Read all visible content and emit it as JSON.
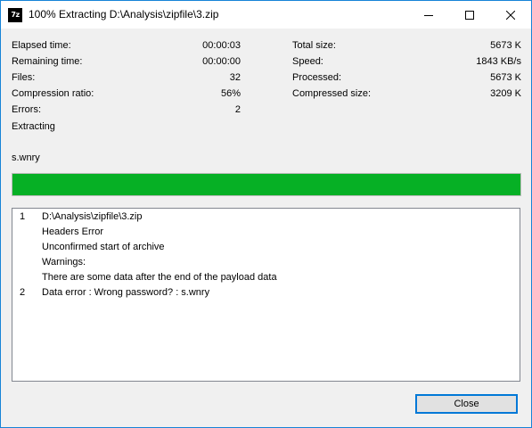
{
  "window": {
    "title": "100% Extracting D:\\Analysis\\zipfile\\3.zip",
    "app_icon_text": "7z",
    "accent_color": "#1784d7"
  },
  "stats_left": [
    {
      "label": "Elapsed time:",
      "value": "00:00:03"
    },
    {
      "label": "Remaining time:",
      "value": "00:00:00"
    },
    {
      "label": "Files:",
      "value": "32"
    },
    {
      "label": "Compression ratio:",
      "value": "56%"
    },
    {
      "label": "Errors:",
      "value": "2"
    }
  ],
  "stats_right": [
    {
      "label": "Total size:",
      "value": "5673 K"
    },
    {
      "label": "Speed:",
      "value": "1843 KB/s"
    },
    {
      "label": "Processed:",
      "value": "5673 K"
    },
    {
      "label": "Compressed size:",
      "value": "3209 K"
    }
  ],
  "status": "Extracting",
  "current_file": "s.wnry",
  "progress": {
    "percent": 100,
    "color": "#06b025"
  },
  "log": [
    {
      "num": "1",
      "text": "D:\\Analysis\\zipfile\\3.zip"
    },
    {
      "num": "",
      "text": "Headers Error"
    },
    {
      "num": "",
      "text": "Unconfirmed start of archive"
    },
    {
      "num": "",
      "text": "Warnings:"
    },
    {
      "num": "",
      "text": "There are some data after the end of the payload data"
    },
    {
      "num": "2",
      "text": "Data error : Wrong password? : s.wnry"
    }
  ],
  "buttons": {
    "close_label": "Close"
  },
  "window_controls": {
    "minimize_icon": "minimize-icon",
    "maximize_icon": "maximize-icon",
    "close_icon": "close-icon"
  }
}
